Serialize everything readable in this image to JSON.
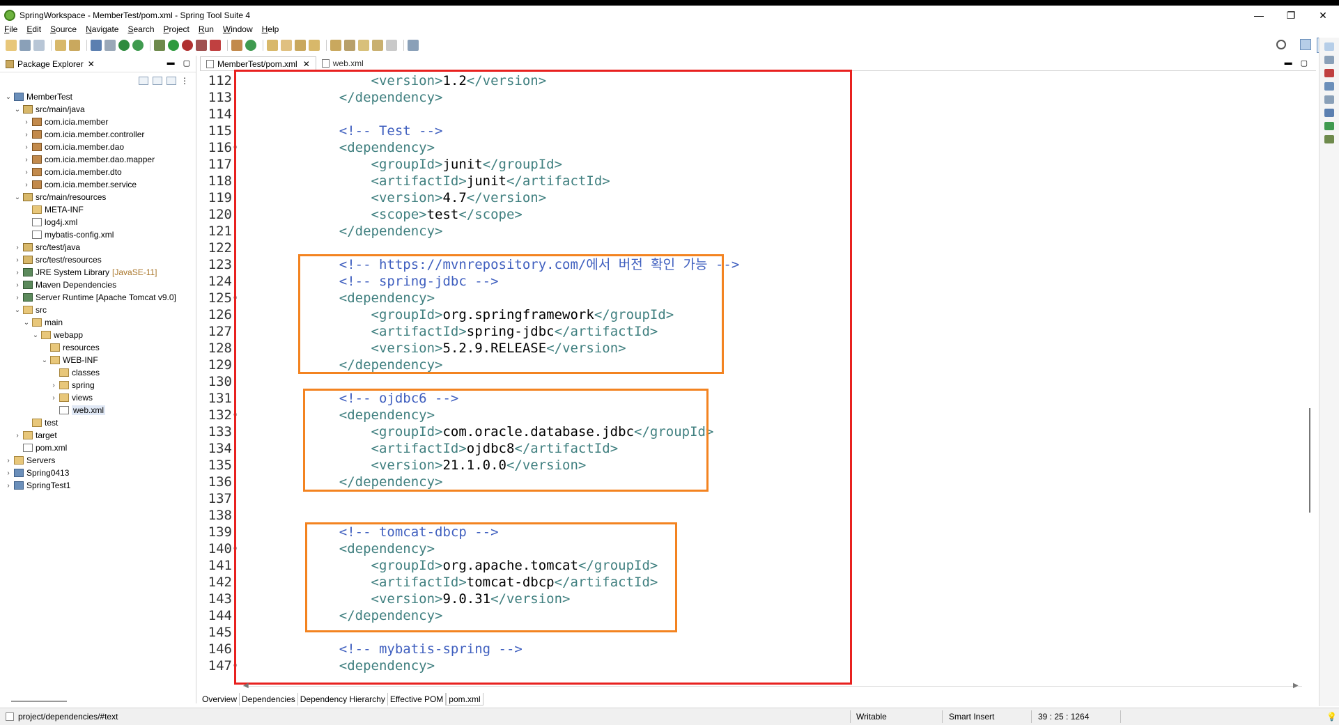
{
  "window": {
    "title": "SpringWorkspace - MemberTest/pom.xml - Spring Tool Suite 4",
    "controls": [
      "—",
      "❐",
      "✕"
    ]
  },
  "menu": [
    "File",
    "Edit",
    "Source",
    "Navigate",
    "Search",
    "Project",
    "Run",
    "Window",
    "Help"
  ],
  "package_explorer": {
    "title": "Package Explorer",
    "tree": [
      {
        "label": "MemberTest",
        "icon": "project-icon",
        "twisty": "v"
      },
      {
        "label": "src/main/java",
        "icon": "source-folder-icon",
        "twisty": "v"
      },
      {
        "label": "com.icia.member",
        "icon": "package-icon",
        "twisty": ">"
      },
      {
        "label": "com.icia.member.controller",
        "icon": "package-icon",
        "twisty": ">"
      },
      {
        "label": "com.icia.member.dao",
        "icon": "package-icon",
        "twisty": ">"
      },
      {
        "label": "com.icia.member.dao.mapper",
        "icon": "package-icon",
        "twisty": ">"
      },
      {
        "label": "com.icia.member.dto",
        "icon": "package-icon",
        "twisty": ">"
      },
      {
        "label": "com.icia.member.service",
        "icon": "package-icon",
        "twisty": ">"
      },
      {
        "label": "src/main/resources",
        "icon": "source-folder-icon",
        "twisty": "v"
      },
      {
        "label": "META-INF",
        "icon": "folder-icon",
        "twisty": ""
      },
      {
        "label": "log4j.xml",
        "icon": "xml-file-icon",
        "twisty": ""
      },
      {
        "label": "mybatis-config.xml",
        "icon": "xml-file-icon",
        "twisty": ""
      },
      {
        "label": "src/test/java",
        "icon": "source-folder-icon",
        "twisty": ">"
      },
      {
        "label": "src/test/resources",
        "icon": "source-folder-icon",
        "twisty": ">"
      },
      {
        "label": "JRE System Library",
        "decor": "[JavaSE-11]",
        "icon": "library-icon",
        "twisty": ">"
      },
      {
        "label": "Maven Dependencies",
        "icon": "library-icon",
        "twisty": ">"
      },
      {
        "label": "Server Runtime [Apache Tomcat v9.0]",
        "icon": "library-icon",
        "twisty": ">"
      },
      {
        "label": "src",
        "icon": "folder-icon",
        "twisty": "v"
      },
      {
        "label": "main",
        "icon": "folder-icon",
        "twisty": "v"
      },
      {
        "label": "webapp",
        "icon": "folder-icon",
        "twisty": "v"
      },
      {
        "label": "resources",
        "icon": "folder-icon",
        "twisty": ""
      },
      {
        "label": "WEB-INF",
        "icon": "folder-icon",
        "twisty": "v"
      },
      {
        "label": "classes",
        "icon": "folder-icon",
        "twisty": ""
      },
      {
        "label": "spring",
        "icon": "folder-icon",
        "twisty": ">"
      },
      {
        "label": "views",
        "icon": "folder-icon",
        "twisty": ">"
      },
      {
        "label": "web.xml",
        "icon": "xml-file-icon",
        "twisty": ""
      },
      {
        "label": "test",
        "icon": "folder-icon",
        "twisty": ""
      },
      {
        "label": "target",
        "icon": "folder-icon",
        "twisty": ">"
      },
      {
        "label": "pom.xml",
        "icon": "xml-file-icon",
        "twisty": ""
      },
      {
        "label": "Servers",
        "icon": "folder-icon",
        "twisty": ">"
      },
      {
        "label": "Spring0413",
        "icon": "project-icon",
        "twisty": ">"
      },
      {
        "label": "SpringTest1",
        "icon": "project-icon",
        "twisty": ">"
      }
    ],
    "selected": "web.xml"
  },
  "editor": {
    "tabs": [
      {
        "label": "MemberTest/pom.xml",
        "active": true,
        "closable": true
      },
      {
        "label": "web.xml",
        "active": false,
        "closable": false
      }
    ],
    "lines": [
      {
        "n": "112",
        "parts": [
          [
            "t",
            "        <version>"
          ],
          [
            "v",
            "1.2"
          ],
          [
            "t",
            "</version>"
          ]
        ]
      },
      {
        "n": "113",
        "parts": [
          [
            "t",
            "    </dependency>"
          ]
        ]
      },
      {
        "n": "114",
        "parts": []
      },
      {
        "n": "115",
        "parts": [
          [
            "c",
            "    <!-- Test -->"
          ]
        ]
      },
      {
        "n": "116",
        "parts": [
          [
            "t",
            "    <dependency>"
          ]
        ]
      },
      {
        "n": "117",
        "parts": [
          [
            "t",
            "        <groupId>"
          ],
          [
            "v",
            "junit"
          ],
          [
            "t",
            "</groupId>"
          ]
        ]
      },
      {
        "n": "118",
        "parts": [
          [
            "t",
            "        <artifactId>"
          ],
          [
            "v",
            "junit"
          ],
          [
            "t",
            "</artifactId>"
          ]
        ]
      },
      {
        "n": "119",
        "parts": [
          [
            "t",
            "        <version>"
          ],
          [
            "v",
            "4.7"
          ],
          [
            "t",
            "</version>"
          ]
        ]
      },
      {
        "n": "120",
        "parts": [
          [
            "t",
            "        <scope>"
          ],
          [
            "v",
            "test"
          ],
          [
            "t",
            "</scope>"
          ]
        ]
      },
      {
        "n": "121",
        "parts": [
          [
            "t",
            "    </dependency>"
          ]
        ]
      },
      {
        "n": "122",
        "parts": []
      },
      {
        "n": "123",
        "parts": [
          [
            "c",
            "    <!-- https://mvnrepository.com/에서 버전 확인 가능 -->"
          ]
        ]
      },
      {
        "n": "124",
        "parts": [
          [
            "c",
            "    <!-- spring-jdbc -->"
          ]
        ]
      },
      {
        "n": "125",
        "parts": [
          [
            "t",
            "    <dependency>"
          ]
        ]
      },
      {
        "n": "126",
        "parts": [
          [
            "t",
            "        <groupId>"
          ],
          [
            "v",
            "org.springframework"
          ],
          [
            "t",
            "</groupId>"
          ]
        ]
      },
      {
        "n": "127",
        "parts": [
          [
            "t",
            "        <artifactId>"
          ],
          [
            "v",
            "spring-jdbc"
          ],
          [
            "t",
            "</artifactId>"
          ]
        ]
      },
      {
        "n": "128",
        "parts": [
          [
            "t",
            "        <version>"
          ],
          [
            "v",
            "5.2.9.RELEASE"
          ],
          [
            "t",
            "</version>"
          ]
        ]
      },
      {
        "n": "129",
        "parts": [
          [
            "t",
            "    </dependency>"
          ]
        ]
      },
      {
        "n": "130",
        "parts": []
      },
      {
        "n": "131",
        "parts": [
          [
            "c",
            "    <!-- ojdbc6 -->"
          ]
        ]
      },
      {
        "n": "132",
        "parts": [
          [
            "t",
            "    <dependency>"
          ]
        ]
      },
      {
        "n": "133",
        "parts": [
          [
            "t",
            "        <groupId>"
          ],
          [
            "v",
            "com.oracle.database.jdbc"
          ],
          [
            "t",
            "</groupId>"
          ]
        ]
      },
      {
        "n": "134",
        "parts": [
          [
            "t",
            "        <artifactId>"
          ],
          [
            "v",
            "ojdbc8"
          ],
          [
            "t",
            "</artifactId>"
          ]
        ]
      },
      {
        "n": "135",
        "parts": [
          [
            "t",
            "        <version>"
          ],
          [
            "v",
            "21.1.0.0"
          ],
          [
            "t",
            "</version>"
          ]
        ]
      },
      {
        "n": "136",
        "parts": [
          [
            "t",
            "    </dependency>"
          ]
        ]
      },
      {
        "n": "137",
        "parts": []
      },
      {
        "n": "138",
        "parts": []
      },
      {
        "n": "139",
        "parts": [
          [
            "c",
            "    <!-- tomcat-dbcp -->"
          ]
        ]
      },
      {
        "n": "140",
        "parts": [
          [
            "t",
            "    <dependency>"
          ]
        ]
      },
      {
        "n": "141",
        "parts": [
          [
            "t",
            "        <groupId>"
          ],
          [
            "v",
            "org.apache.tomcat"
          ],
          [
            "t",
            "</groupId>"
          ]
        ]
      },
      {
        "n": "142",
        "parts": [
          [
            "t",
            "        <artifactId>"
          ],
          [
            "v",
            "tomcat-dbcp"
          ],
          [
            "t",
            "</artifactId>"
          ]
        ]
      },
      {
        "n": "143",
        "parts": [
          [
            "t",
            "        <version>"
          ],
          [
            "v",
            "9.0.31"
          ],
          [
            "t",
            "</version>"
          ]
        ]
      },
      {
        "n": "144",
        "parts": [
          [
            "t",
            "    </dependency>"
          ]
        ]
      },
      {
        "n": "145",
        "parts": []
      },
      {
        "n": "146",
        "parts": [
          [
            "c",
            "    <!-- mybatis-spring -->"
          ]
        ]
      },
      {
        "n": "147",
        "parts": [
          [
            "t",
            "    <dependency>"
          ]
        ]
      }
    ],
    "bottom_tabs": [
      "Overview",
      "Dependencies",
      "Dependency Hierarchy",
      "Effective POM",
      "pom.xml"
    ],
    "active_bottom_tab": "pom.xml"
  },
  "status": {
    "path": "project/dependencies/#text",
    "mode": "Writable",
    "insert": "Smart Insert",
    "position": "39 : 25 : 1264"
  },
  "colors": {
    "tag": "#3f7f7f",
    "comment": "#3f5fbf",
    "highlight_red": "#e8211f",
    "highlight_orange": "#f38320"
  }
}
